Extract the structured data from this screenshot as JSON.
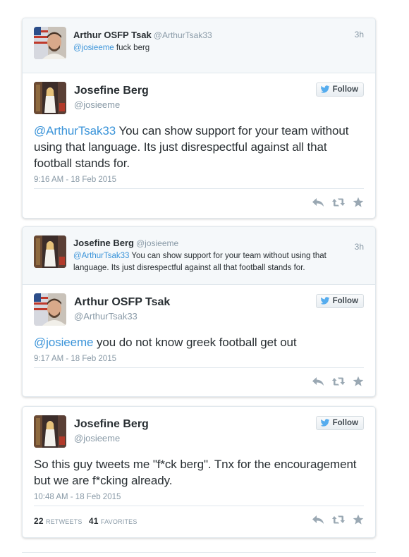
{
  "colors": {
    "link": "#3b94d9",
    "muted": "#8899a6",
    "text": "#292f33",
    "border": "#e1e8ed"
  },
  "cards": [
    {
      "parent": {
        "name": "Arthur OSFP Tsak",
        "handle": "@ArthurTsak33",
        "time": "3h",
        "mention": "@josieeme",
        "text": " fuck berg"
      },
      "main": {
        "name": "Josefine Berg",
        "handle": "@josieeme",
        "follow": "Follow",
        "mention": "@ArthurTsak33",
        "text": " You can show support for your team without using that language. Its just disrespectful against all that football stands for.",
        "timestamp": "9:16 AM - 18 Feb 2015"
      }
    },
    {
      "parent": {
        "name": "Josefine Berg",
        "handle": "@josieeme",
        "time": "3h",
        "mention": "@ArthurTsak33",
        "text": " You can show support for your team without using that language. Its just disrespectful against all that football stands for."
      },
      "main": {
        "name": "Arthur OSFP Tsak",
        "handle": "@ArthurTsak33",
        "follow": "Follow",
        "mention": "@josieeme",
        "text": " you do not know greek football get out",
        "timestamp": "9:17 AM - 18 Feb 2015"
      }
    },
    {
      "main": {
        "name": "Josefine Berg",
        "handle": "@josieeme",
        "follow": "Follow",
        "text": "So this guy tweets me \"f*ck berg\". Tnx for the encouragement but we are f*cking already.",
        "timestamp": "10:48 AM - 18 Feb 2015",
        "retweets": "22",
        "retweets_label": "RETWEETS",
        "favorites": "41",
        "favorites_label": "FAVORITES"
      }
    }
  ],
  "icons": {
    "reply": "reply-icon",
    "retweet": "retweet-icon",
    "favorite": "star-icon",
    "bird": "twitter-bird-icon"
  }
}
